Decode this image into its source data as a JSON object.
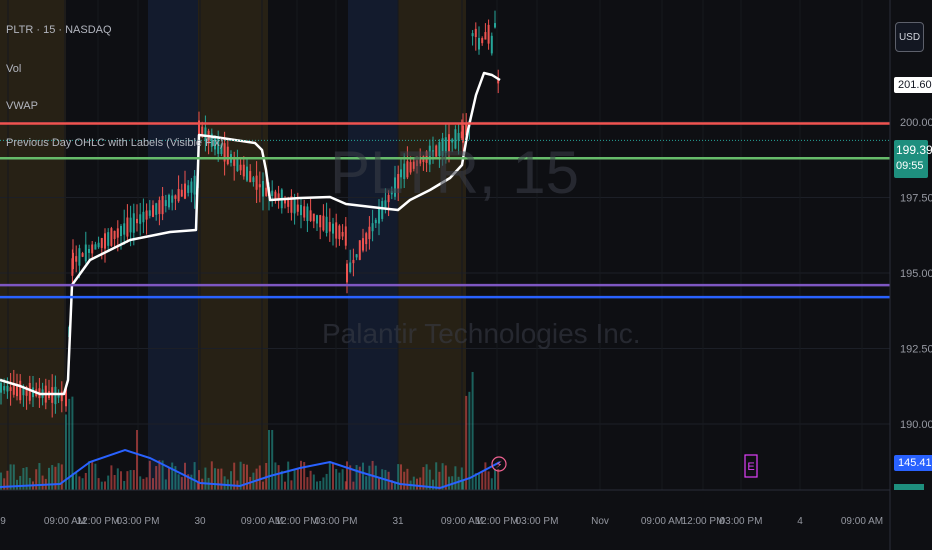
{
  "legend": {
    "symbol_line": "PLTR · 15 · NASDAQ",
    "vol": "Vol",
    "vwap": "VWAP",
    "indicator": "Previous Day OHLC with Labels (Visible Fix)"
  },
  "currency_button": "USD",
  "watermark": {
    "ticker": "PLTR, 15",
    "company": "Palantir Technologies Inc."
  },
  "price_axis": {
    "ticks": [
      {
        "label": "200.00",
        "value": 200.0
      },
      {
        "label": "197.50",
        "value": 197.5
      },
      {
        "label": "195.00",
        "value": 195.0
      },
      {
        "label": "192.50",
        "value": 192.5
      },
      {
        "label": "190.00",
        "value": 190.0
      }
    ],
    "last_price_tag": {
      "label": "199.39",
      "value": 199.39,
      "countdown": "09:55"
    },
    "vwap_tag": {
      "label": "201.60",
      "value": 201.6
    },
    "volume_tag": {
      "label": "145.41K"
    }
  },
  "time_axis": {
    "labels": [
      "9",
      "09:00 AM",
      "12:00 PM",
      "03:00 PM",
      "30",
      "09:00 AM",
      "12:00 PM",
      "03:00 PM",
      "31",
      "09:00 AM",
      "12:00 PM",
      "03:00 PM",
      "Nov",
      "09:00 AM",
      "12:00 PM",
      "03:00 PM",
      "4",
      "09:00 AM"
    ]
  },
  "levels": [
    {
      "name": "previous-day-high",
      "value": 199.95,
      "color": "#f05350"
    },
    {
      "name": "previous-day-close",
      "value": 198.8,
      "color": "#66bb6a"
    },
    {
      "name": "previous-day-low",
      "value": 194.6,
      "color": "#7e57c2"
    },
    {
      "name": "previous-day-open",
      "value": 194.2,
      "color": "#2962ff"
    }
  ],
  "earnings_marker": "E",
  "colors": {
    "up": "#26a69a",
    "down": "#ef5350",
    "vwap": "#ffffff",
    "premarket_bg": "#2b2416",
    "afterhours_bg": "#141d33",
    "volume_ma": "#2962ff"
  },
  "chart_data": {
    "type": "candlestick",
    "title": "PLTR · 15 · NASDAQ",
    "y_range": [
      188.7,
      203.6
    ],
    "sessions": [
      {
        "day": "29",
        "open": 188.9,
        "close": 192.3
      },
      {
        "day": "30",
        "open": 199.9,
        "close": 196.6
      },
      {
        "day": "31",
        "open": 197.2,
        "close": 199.39
      }
    ],
    "vwap_end": 201.6,
    "last_price": 199.39
  }
}
